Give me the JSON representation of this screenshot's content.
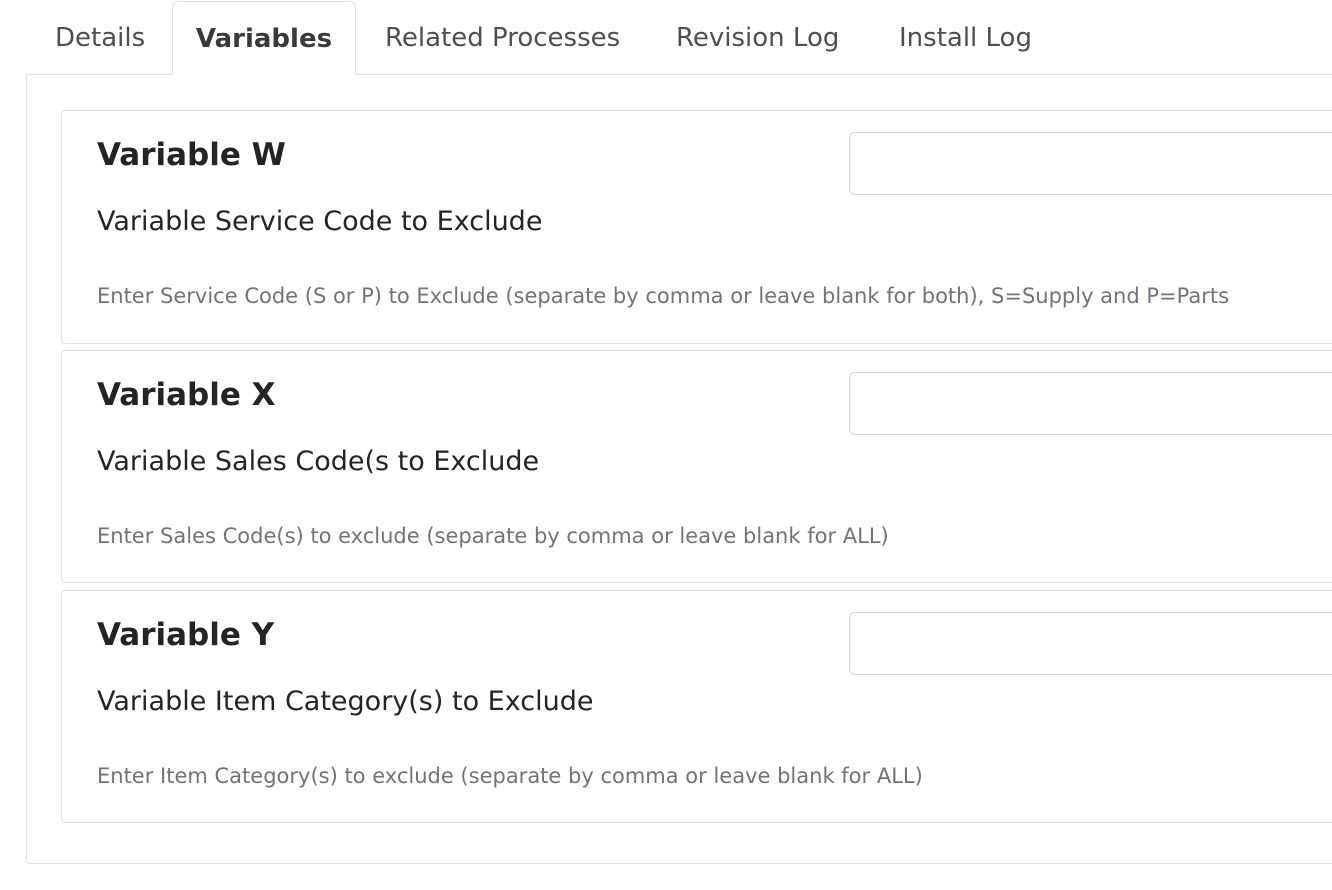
{
  "tabs": [
    {
      "label": "Details",
      "active": false
    },
    {
      "label": "Variables",
      "active": true
    },
    {
      "label": "Related Processes",
      "active": false
    },
    {
      "label": "Revision Log",
      "active": false
    },
    {
      "label": "Install Log",
      "active": false
    }
  ],
  "variables": [
    {
      "title": "Variable W",
      "label": "Variable Service Code to Exclude",
      "help": "Enter Service Code (S or P) to Exclude (separate by comma or leave blank for both), S=Supply and P=Parts",
      "value": ""
    },
    {
      "title": "Variable X",
      "label": "Variable Sales Code(s to Exclude",
      "help": "Enter Sales Code(s) to exclude (separate by comma or leave blank for ALL)",
      "value": ""
    },
    {
      "title": "Variable Y",
      "label": "Variable Item Category(s) to Exclude",
      "help": "Enter Item Category(s) to exclude (separate by comma or leave blank for ALL)",
      "value": ""
    }
  ]
}
